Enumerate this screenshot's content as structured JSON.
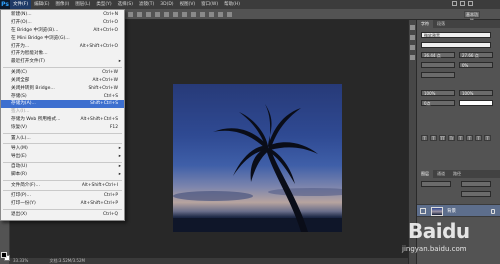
{
  "app": {
    "logo": "Ps"
  },
  "menubar": {
    "items": [
      "文件(F)",
      "编辑(E)",
      "图像(I)",
      "图层(L)",
      "类型(Y)",
      "选择(S)",
      "滤镜(T)",
      "3D(D)",
      "视图(V)",
      "窗口(W)",
      "帮助(H)"
    ]
  },
  "options": {
    "workspace": "基本功能"
  },
  "file_menu": {
    "items": [
      {
        "label": "新建(N)...",
        "shortcut": "Ctrl+N"
      },
      {
        "label": "打开(O)...",
        "shortcut": "Ctrl+O"
      },
      {
        "label": "在 Bridge 中浏览(B)...",
        "shortcut": "Alt+Ctrl+O"
      },
      {
        "label": "在 Mini Bridge 中浏览(G)...",
        "shortcut": ""
      },
      {
        "label": "打开为...",
        "shortcut": "Alt+Shift+Ctrl+O"
      },
      {
        "label": "打开为智能对象...",
        "shortcut": ""
      },
      {
        "label": "最近打开文件(T)",
        "shortcut": "",
        "submenu": true
      },
      {
        "sep": true
      },
      {
        "label": "关闭(C)",
        "shortcut": "Ctrl+W"
      },
      {
        "label": "关闭全部",
        "shortcut": "Alt+Ctrl+W"
      },
      {
        "label": "关闭并转到 Bridge...",
        "shortcut": "Shift+Ctrl+W"
      },
      {
        "label": "存储(S)",
        "shortcut": "Ctrl+S"
      },
      {
        "label": "存储为(A)...",
        "shortcut": "Shift+Ctrl+S",
        "highlight": true
      },
      {
        "label": "签入(I)...",
        "shortcut": "",
        "disabled": true
      },
      {
        "label": "存储为 Web 所用格式...",
        "shortcut": "Alt+Shift+Ctrl+S"
      },
      {
        "label": "恢复(V)",
        "shortcut": "F12"
      },
      {
        "sep": true
      },
      {
        "label": "置入(L)...",
        "shortcut": ""
      },
      {
        "sep": true
      },
      {
        "label": "导入(M)",
        "shortcut": "",
        "submenu": true
      },
      {
        "label": "导出(E)",
        "shortcut": "",
        "submenu": true
      },
      {
        "sep": true
      },
      {
        "label": "自动(U)",
        "shortcut": "",
        "submenu": true
      },
      {
        "label": "脚本(R)",
        "shortcut": "",
        "submenu": true
      },
      {
        "sep": true
      },
      {
        "label": "文件简介(F)...",
        "shortcut": "Alt+Shift+Ctrl+I"
      },
      {
        "sep": true
      },
      {
        "label": "打印(P)...",
        "shortcut": "Ctrl+P"
      },
      {
        "label": "打印一份(Y)",
        "shortcut": "Alt+Shift+Ctrl+P"
      },
      {
        "sep": true
      },
      {
        "label": "退出(X)",
        "shortcut": "Ctrl+Q"
      }
    ]
  },
  "character_panel": {
    "tabs": [
      "字符",
      "段落"
    ],
    "font_style": "微软雅黑",
    "font_size": "36.44 点",
    "leading": "27.66 点",
    "tracking": "0%",
    "scale_v": "100%",
    "scale_h": "100%",
    "baseline": "0点",
    "style_buttons": [
      "T",
      "T",
      "TT",
      "Tr",
      "T",
      "T",
      "T",
      "T"
    ]
  },
  "layers_panel": {
    "tabs": [
      "图层",
      "通道",
      "路径"
    ],
    "layer_name": "背景"
  },
  "status": {
    "zoom": "33.33%",
    "doc": "文档:3.52M/3.52M"
  },
  "watermark": {
    "brand": "Baidu",
    "site": "jingyan.baidu.com"
  }
}
